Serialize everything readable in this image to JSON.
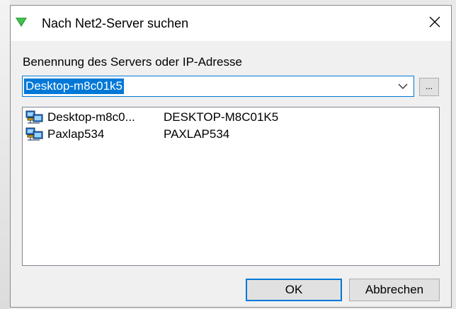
{
  "window": {
    "title": "Nach Net2-Server suchen",
    "icon": "green-triangle-down-icon",
    "close_icon": "close-icon"
  },
  "form": {
    "server_label": "Benennung des Servers oder IP-Adresse",
    "server_value": "Desktop-m8c01k5",
    "browse_label": "..."
  },
  "servers": [
    {
      "name": "Desktop-m8c0...",
      "host": "DESKTOP-M8C01K5",
      "icon": "network-computer-icon"
    },
    {
      "name": "Paxlap534",
      "host": "PAXLAP534",
      "icon": "network-computer-icon"
    }
  ],
  "buttons": {
    "ok": "OK",
    "cancel": "Abbrechen"
  },
  "colors": {
    "accent": "#0078d7",
    "title_icon": "#2e9e3a"
  }
}
